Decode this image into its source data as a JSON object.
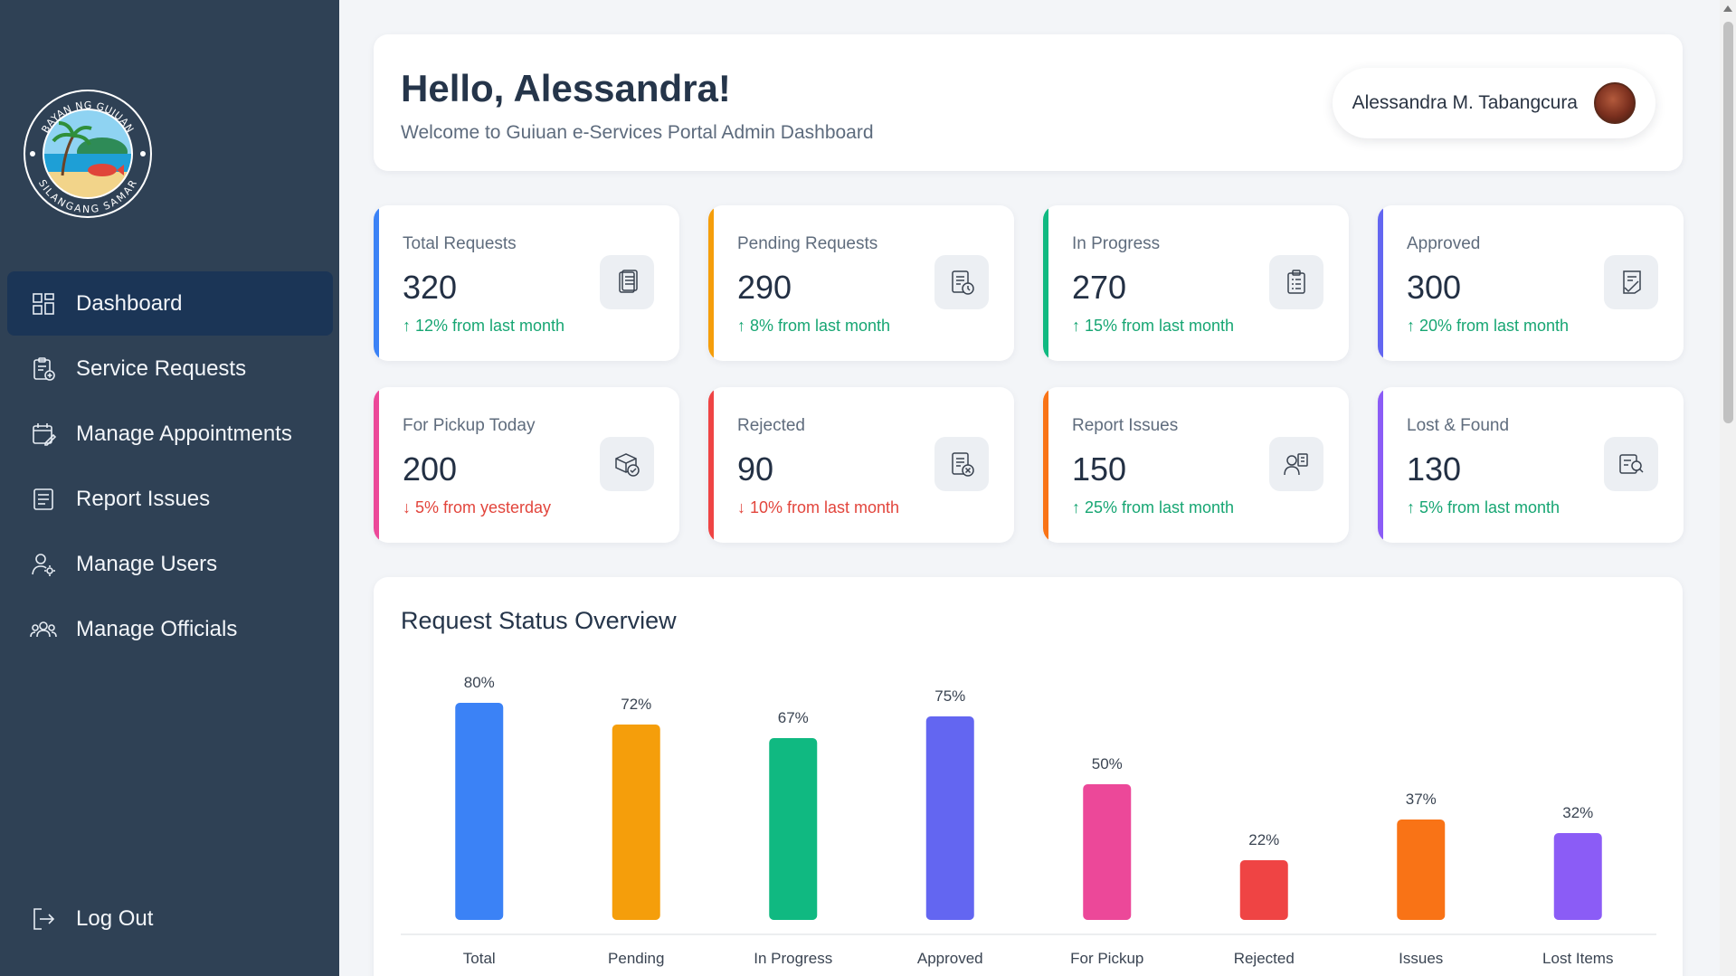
{
  "logo": {
    "top_text": "BAYAN NG GUIUAN",
    "bottom_text": "SILANGANG SAMAR"
  },
  "sidebar": {
    "items": [
      {
        "label": "Dashboard",
        "icon": "grid-icon",
        "active": true
      },
      {
        "label": "Service Requests",
        "icon": "clipboard-plus-icon"
      },
      {
        "label": "Manage Appointments",
        "icon": "calendar-edit-icon"
      },
      {
        "label": "Report Issues",
        "icon": "document-list-icon"
      },
      {
        "label": "Manage Users",
        "icon": "user-gear-icon"
      },
      {
        "label": "Manage Officials",
        "icon": "users-group-icon"
      }
    ],
    "logout": {
      "label": "Log Out",
      "icon": "logout-icon"
    }
  },
  "header": {
    "greeting": "Hello, Alessandra!",
    "subtitle": "Welcome to Guiuan e-Services Portal Admin Dashboard",
    "user_name": "Alessandra M. Tabangcura"
  },
  "stats": [
    {
      "label": "Total Requests",
      "value": "320",
      "change": "↑ 12% from last month",
      "trend": "up",
      "color": "#3b82f6",
      "icon": "documents-icon"
    },
    {
      "label": "Pending Requests",
      "value": "290",
      "change": "↑ 8% from last month",
      "trend": "up",
      "color": "#f59e0b",
      "icon": "document-clock-icon"
    },
    {
      "label": "In Progress",
      "value": "270",
      "change": "↑ 15% from last month",
      "trend": "up",
      "color": "#10b981",
      "icon": "clipboard-list-icon"
    },
    {
      "label": "Approved",
      "value": "300",
      "change": "↑ 20% from last month",
      "trend": "up",
      "color": "#6366f1",
      "icon": "document-check-icon"
    },
    {
      "label": "For Pickup Today",
      "value": "200",
      "change": "↓ 5% from yesterday",
      "trend": "down",
      "color": "#ec4899",
      "icon": "package-check-icon"
    },
    {
      "label": "Rejected",
      "value": "90",
      "change": "↓ 10% from last month",
      "trend": "down",
      "color": "#ef4444",
      "icon": "document-x-icon"
    },
    {
      "label": "Report Issues",
      "value": "150",
      "change": "↑ 25% from last month",
      "trend": "up",
      "color": "#f97316",
      "icon": "person-report-icon"
    },
    {
      "label": "Lost & Found",
      "value": "130",
      "change": "↑ 5% from last month",
      "trend": "up",
      "color": "#8b5cf6",
      "icon": "search-box-icon"
    }
  ],
  "chart_card": {
    "title": "Request Status Overview"
  },
  "chart_data": {
    "type": "bar",
    "title": "Request Status Overview",
    "categories": [
      "Total",
      "Pending",
      "In Progress",
      "Approved",
      "For Pickup",
      "Rejected",
      "Issues",
      "Lost Items"
    ],
    "values": [
      80,
      72,
      67,
      75,
      50,
      22,
      37,
      32
    ],
    "value_labels": [
      "80%",
      "72%",
      "67%",
      "75%",
      "50%",
      "22%",
      "37%",
      "32%"
    ],
    "colors": [
      "#3b82f6",
      "#f59e0b",
      "#10b981",
      "#6366f1",
      "#ec4899",
      "#ef4444",
      "#f97316",
      "#8b5cf6"
    ],
    "ylim": [
      0,
      100
    ],
    "grid": false,
    "xlabel": "",
    "ylabel": ""
  }
}
